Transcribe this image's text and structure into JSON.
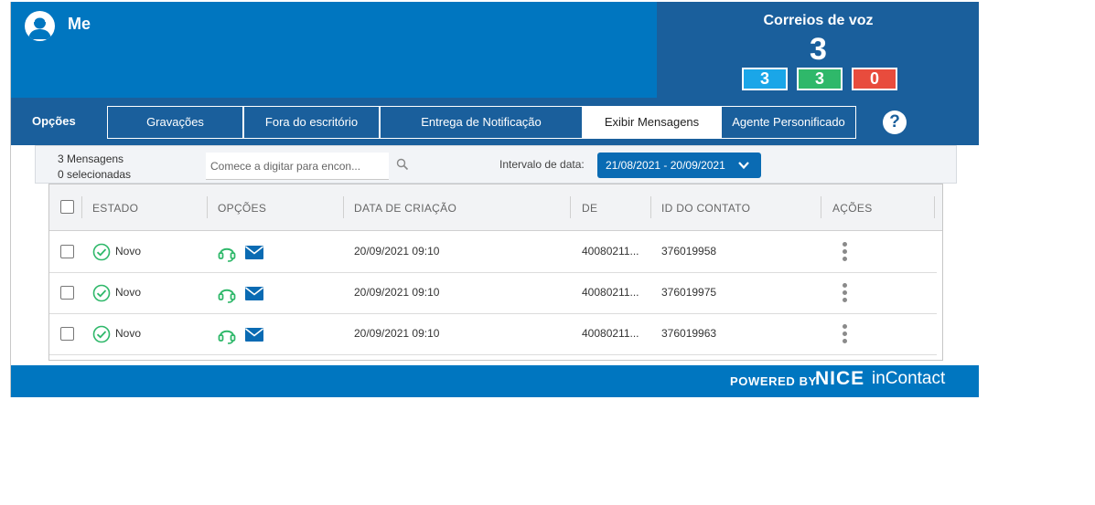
{
  "header": {
    "user_name": "Me",
    "avatar_icon": "user-avatar-icon"
  },
  "voicemail": {
    "title": "Correios de voz",
    "total": "3",
    "counters": [
      {
        "value": "3",
        "color": "#1aa6e8"
      },
      {
        "value": "3",
        "color": "#2fb86a"
      },
      {
        "value": "0",
        "color": "#e84c3d"
      }
    ]
  },
  "options": {
    "label": "Opções",
    "tabs": [
      {
        "label": "Gravações",
        "active": false
      },
      {
        "label": "Fora do escritório",
        "active": false
      },
      {
        "label": "Entrega de Notificação",
        "active": false
      },
      {
        "label": "Exibir Mensagens",
        "active": true
      },
      {
        "label": "Agente Personificado",
        "active": false
      }
    ],
    "help_label": "?"
  },
  "toolbar": {
    "message_count": "3 Mensagens",
    "selected_count": "0 selecionadas",
    "search_placeholder": "Comece a digitar para encon...",
    "date_label": "Intervalo de data:",
    "date_range": "21/08/2021 - 20/09/2021"
  },
  "table": {
    "columns": [
      "ESTADO",
      "OPÇÕES",
      "DATA DE CRIAÇÃO",
      "DE",
      "ID DO CONTATO",
      "AÇÕES"
    ],
    "rows": [
      {
        "status": "Novo",
        "created": "20/09/2021 09:10",
        "from": "40080211...",
        "contact_id": "376019958"
      },
      {
        "status": "Novo",
        "created": "20/09/2021 09:10",
        "from": "40080211...",
        "contact_id": "376019975"
      },
      {
        "status": "Novo",
        "created": "20/09/2021 09:10",
        "from": "40080211...",
        "contact_id": "376019963"
      }
    ]
  },
  "footer": {
    "powered_by": "POWERED BY",
    "brand_nice": "NICE",
    "brand_product": "inContact"
  },
  "colors": {
    "header_blue": "#0076c0",
    "dark_blue": "#1a5f9c",
    "status_green": "#2fb86a",
    "mail_blue": "#0a6bb3"
  }
}
